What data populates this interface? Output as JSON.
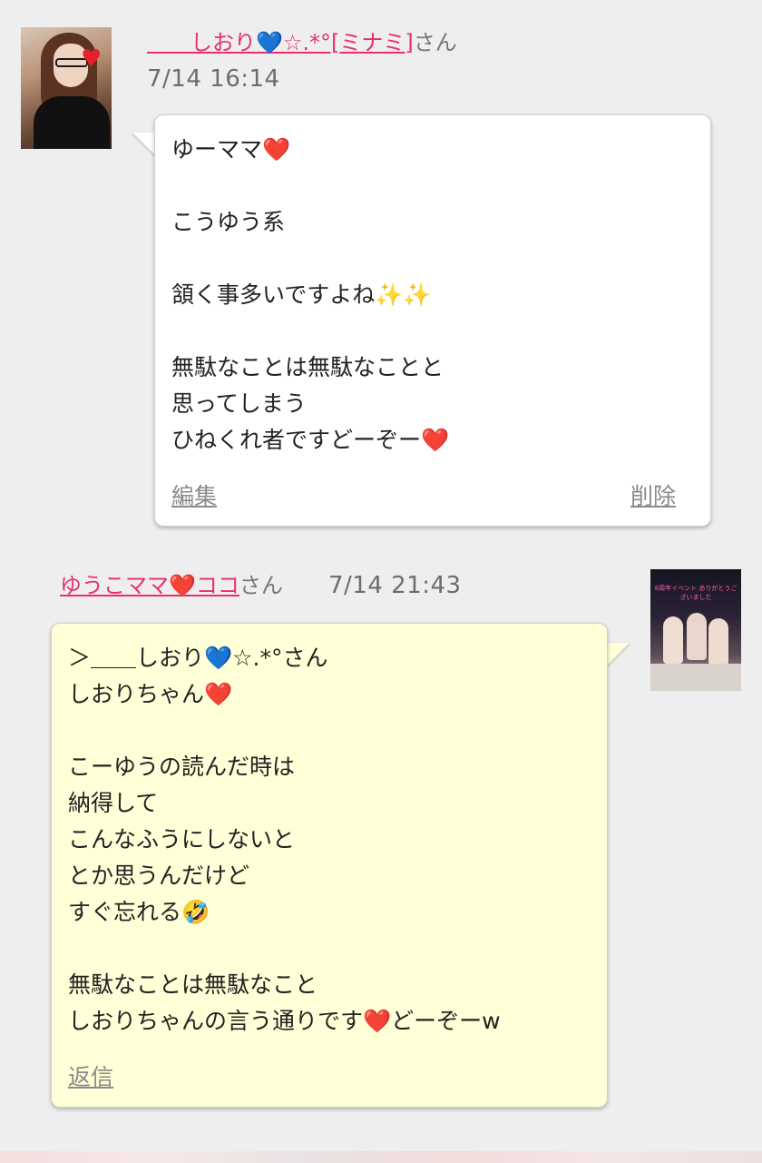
{
  "post1": {
    "author_name": "＿＿しおり💙☆.*°[ミナミ]",
    "author_suffix": "さん",
    "timestamp": "7/14 16:14",
    "lines": [
      "ゆーママ❤️",
      "",
      "こうゆう系",
      "",
      "頷く事多いですよね✨✨",
      "",
      "無駄なことは無駄なことと",
      "思ってしまう",
      "ひねくれ者ですどーぞー❤️"
    ],
    "edit_label": "編集",
    "delete_label": "削除"
  },
  "post2": {
    "author_name": "ゆうこママ❤️ココ",
    "author_suffix": "さん",
    "timestamp": "7/14 21:43",
    "lines": [
      "＞＿＿しおり💙☆.*°さん",
      "しおりちゃん❤️",
      "",
      "こーゆうの読んだ時は",
      "納得して",
      "こんなふうにしないと",
      "とか思うんだけど",
      "すぐ忘れる🤣",
      "",
      "無駄なことは無駄なこと",
      "しおりちゃんの言う通りです❤️どーぞーw"
    ],
    "reply_label": "返信"
  },
  "avatar2_banner": "8周年イベント ありがとうございました",
  "colors": {
    "background": "#eeeeee",
    "name_link": "#e8306e",
    "timestamp": "#6d6d6d",
    "reply_bubble": "#ffffd8"
  }
}
